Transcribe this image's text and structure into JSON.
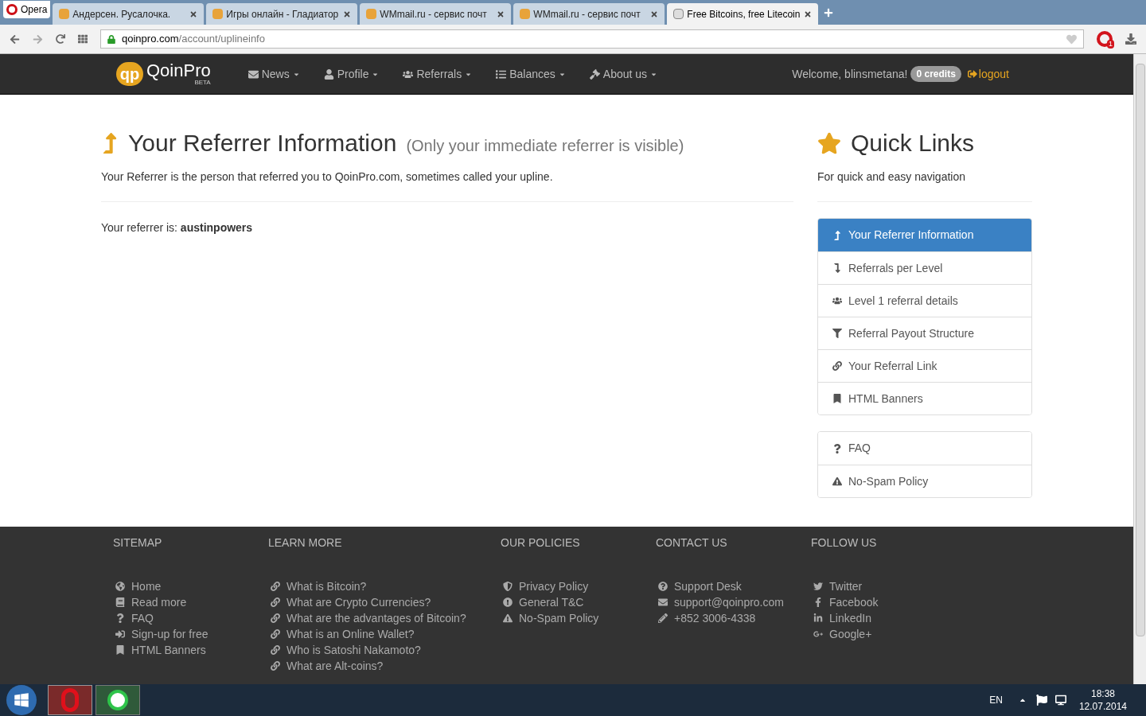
{
  "browser": {
    "menu_label": "Opera",
    "tabs": [
      {
        "title": "Андерсен. Русалочка.",
        "selected": false
      },
      {
        "title": "Игры онлайн - Гладиатор",
        "selected": false
      },
      {
        "title": "WMmail.ru - сервис почт",
        "selected": false
      },
      {
        "title": "WMmail.ru - сервис почт",
        "selected": false
      },
      {
        "title": "Free Bitcoins, free Litecoin",
        "selected": true
      }
    ],
    "url": {
      "host": "qoinpro.com",
      "path": "/account/uplineinfo"
    },
    "notification_count": "1"
  },
  "navbar": {
    "logo": {
      "mark": "qp",
      "name": "QoinPro",
      "badge": "BETA"
    },
    "menus": [
      "News",
      "Profile",
      "Referrals",
      "Balances",
      "About us"
    ],
    "welcome": "Welcome, blinsmetana!",
    "credits": "0 credits",
    "logout": "logout"
  },
  "main": {
    "title": "Your Referrer Information",
    "subtitle": "(Only your immediate referrer is visible)",
    "description": "Your Referrer is the person that referred you to QoinPro.com, sometimes called your upline.",
    "referrer_label": "Your referrer is:",
    "referrer_name": "austinpowers"
  },
  "quick_links": {
    "title": "Quick Links",
    "description": "For quick and easy navigation",
    "groups": [
      [
        {
          "label": "Your Referrer Information",
          "selected": true
        },
        {
          "label": "Referrals per Level",
          "selected": false
        },
        {
          "label": "Level 1 referral details",
          "selected": false
        },
        {
          "label": "Referral Payout Structure",
          "selected": false
        },
        {
          "label": "Your Referral Link",
          "selected": false
        },
        {
          "label": "HTML Banners",
          "selected": false
        }
      ],
      [
        {
          "label": "FAQ",
          "selected": false
        },
        {
          "label": "No-Spam Policy",
          "selected": false
        }
      ]
    ]
  },
  "footer": [
    {
      "heading": "SITEMAP",
      "links": [
        "Home",
        "Read more",
        "FAQ",
        "Sign-up for free",
        "HTML Banners"
      ]
    },
    {
      "heading": "LEARN MORE",
      "links": [
        "What is Bitcoin?",
        "What are Crypto Currencies?",
        "What are the advantages of Bitcoin?",
        "What is an Online Wallet?",
        "Who is Satoshi Nakamoto?",
        "What are Alt-coins?"
      ]
    },
    {
      "heading": "OUR POLICIES",
      "links": [
        "Privacy Policy",
        "General T&C",
        "No-Spam Policy"
      ]
    },
    {
      "heading": "CONTACT US",
      "links": [
        "Support Desk",
        "support@qoinpro.com",
        "+852 3006-4338"
      ]
    },
    {
      "heading": "FOLLOW US",
      "links": [
        "Twitter",
        "Facebook",
        "LinkedIn",
        "Google+"
      ]
    }
  ],
  "taskbar": {
    "language": "EN",
    "time": "18:38",
    "date": "12.07.2014"
  }
}
